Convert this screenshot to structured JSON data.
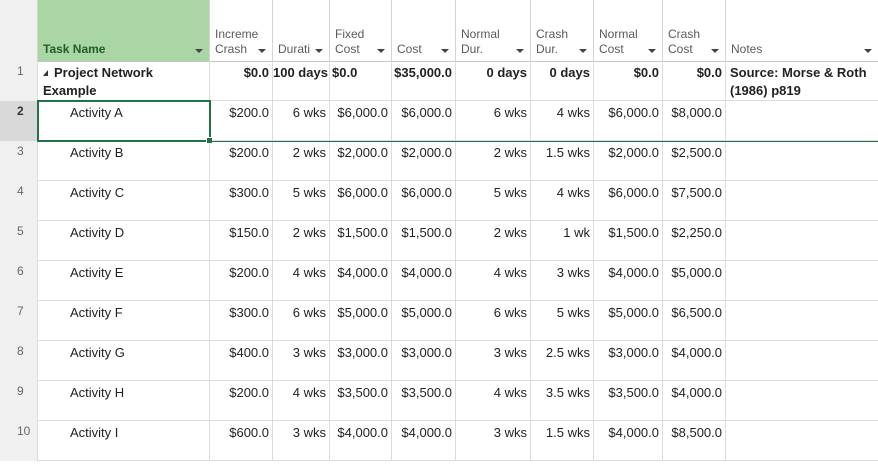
{
  "columns": {
    "row_number": "",
    "task_name": "Task Name",
    "incremental_crash": "Increme\nCrash",
    "duration": "Durati",
    "fixed_cost": "Fixed\nCost",
    "cost": "Cost",
    "normal_dur": "Normal\nDur.",
    "crash_dur": "Crash\nDur.",
    "normal_cost": "Normal\nCost",
    "crash_cost": "Crash\nCost",
    "notes": "Notes"
  },
  "rows": [
    {
      "num": "1",
      "name": "Project Network Example",
      "inc": "$0.0",
      "dur": "100 days",
      "fixed": "$0.0",
      "cost": "$35,000.0",
      "ndur": "0 days",
      "cdur": "0 days",
      "ncost": "$0.0",
      "ccost": "$0.0",
      "notes": "Source: Morse & Roth (1986) p819"
    },
    {
      "num": "2",
      "name": "Activity A",
      "inc": "$200.0",
      "dur": "6 wks",
      "fixed": "$6,000.0",
      "cost": "$6,000.0",
      "ndur": "6 wks",
      "cdur": "4 wks",
      "ncost": "$6,000.0",
      "ccost": "$8,000.0",
      "notes": ""
    },
    {
      "num": "3",
      "name": "Activity B",
      "inc": "$200.0",
      "dur": "2 wks",
      "fixed": "$2,000.0",
      "cost": "$2,000.0",
      "ndur": "2 wks",
      "cdur": "1.5 wks",
      "ncost": "$2,000.0",
      "ccost": "$2,500.0",
      "notes": ""
    },
    {
      "num": "4",
      "name": "Activity C",
      "inc": "$300.0",
      "dur": "5 wks",
      "fixed": "$6,000.0",
      "cost": "$6,000.0",
      "ndur": "5 wks",
      "cdur": "4 wks",
      "ncost": "$6,000.0",
      "ccost": "$7,500.0",
      "notes": ""
    },
    {
      "num": "5",
      "name": "Activity D",
      "inc": "$150.0",
      "dur": "2 wks",
      "fixed": "$1,500.0",
      "cost": "$1,500.0",
      "ndur": "2 wks",
      "cdur": "1 wk",
      "ncost": "$1,500.0",
      "ccost": "$2,250.0",
      "notes": ""
    },
    {
      "num": "6",
      "name": "Activity E",
      "inc": "$200.0",
      "dur": "4 wks",
      "fixed": "$4,000.0",
      "cost": "$4,000.0",
      "ndur": "4 wks",
      "cdur": "3 wks",
      "ncost": "$4,000.0",
      "ccost": "$5,000.0",
      "notes": ""
    },
    {
      "num": "7",
      "name": "Activity F",
      "inc": "$300.0",
      "dur": "6 wks",
      "fixed": "$5,000.0",
      "cost": "$5,000.0",
      "ndur": "6 wks",
      "cdur": "5 wks",
      "ncost": "$5,000.0",
      "ccost": "$6,500.0",
      "notes": ""
    },
    {
      "num": "8",
      "name": "Activity G",
      "inc": "$400.0",
      "dur": "3 wks",
      "fixed": "$3,000.0",
      "cost": "$3,000.0",
      "ndur": "3 wks",
      "cdur": "2.5 wks",
      "ncost": "$3,000.0",
      "ccost": "$4,000.0",
      "notes": ""
    },
    {
      "num": "9",
      "name": "Activity H",
      "inc": "$200.0",
      "dur": "4 wks",
      "fixed": "$3,500.0",
      "cost": "$3,500.0",
      "ndur": "4 wks",
      "cdur": "3.5 wks",
      "ncost": "$3,500.0",
      "ccost": "$4,000.0",
      "notes": ""
    },
    {
      "num": "10",
      "name": "Activity I",
      "inc": "$600.0",
      "dur": "3 wks",
      "fixed": "$4,000.0",
      "cost": "$4,000.0",
      "ndur": "3 wks",
      "cdur": "1.5 wks",
      "ncost": "$4,000.0",
      "ccost": "$8,500.0",
      "notes": ""
    }
  ],
  "selection": {
    "row": "2",
    "column": "task_name"
  },
  "colors": {
    "task_header_bg": "#a9d6a4",
    "selection": "#217346"
  }
}
